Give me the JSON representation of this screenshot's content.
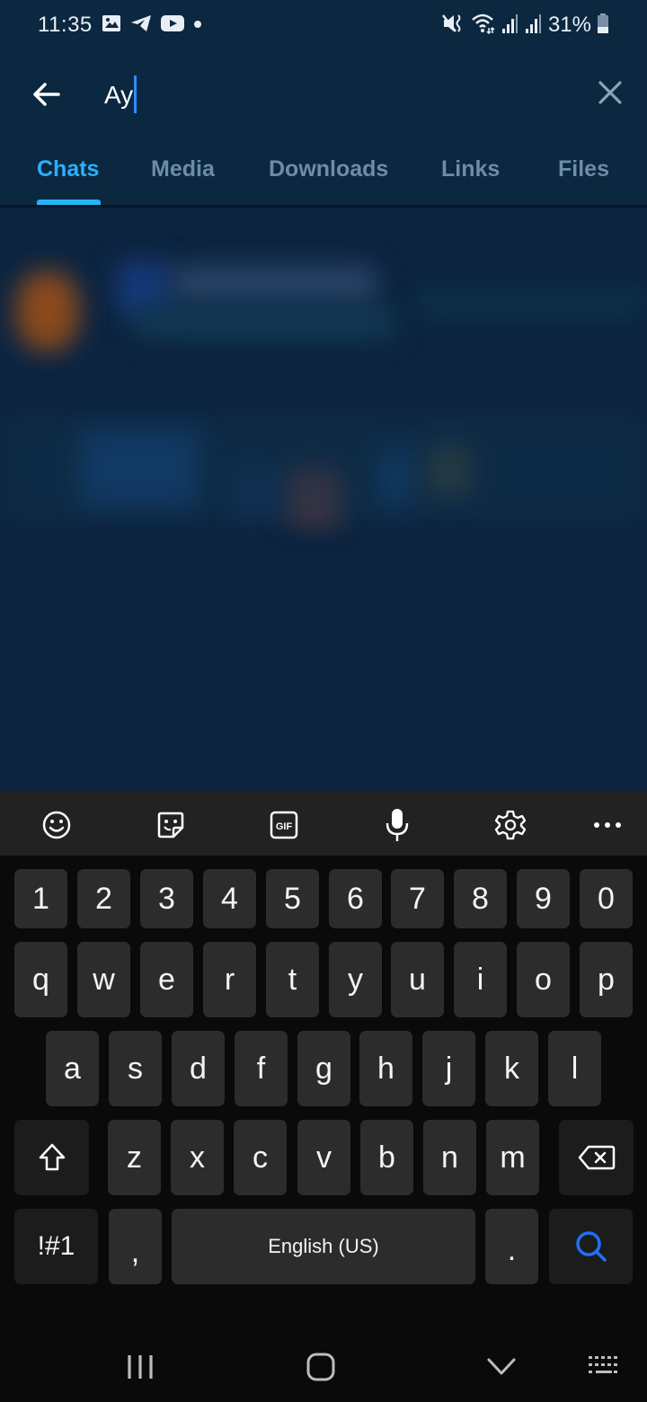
{
  "status_bar": {
    "time": "11:35",
    "battery_percent": "31%",
    "left_icons": [
      "gallery-icon",
      "telegram-icon",
      "youtube-icon",
      "notification-dot-icon"
    ],
    "right_icons": [
      "mute-vibrate-icon",
      "wifi-icon",
      "signal-1-icon",
      "signal-2-icon",
      "battery-icon"
    ]
  },
  "search": {
    "query": "Ay",
    "back_icon": "arrow-left-icon",
    "clear_icon": "close-icon"
  },
  "tabs": [
    {
      "label": "Chats",
      "active": true
    },
    {
      "label": "Media",
      "active": false
    },
    {
      "label": "Downloads",
      "active": false
    },
    {
      "label": "Links",
      "active": false
    },
    {
      "label": "Files",
      "active": false
    }
  ],
  "colors": {
    "app_bg": "#0b2840",
    "accent": "#22b4f5",
    "tab_inactive": "#6d8ca6",
    "keyboard_bg": "#0a0a0a",
    "key_bg": "#2c2c2c",
    "search_key_icon": "#1f6fff"
  },
  "keyboard": {
    "toolbar": [
      "emoji-icon",
      "sticker-icon",
      "gif-icon",
      "microphone-icon",
      "settings-icon",
      "more-icon"
    ],
    "gif_label": "GIF",
    "rows": [
      [
        "1",
        "2",
        "3",
        "4",
        "5",
        "6",
        "7",
        "8",
        "9",
        "0"
      ],
      [
        "q",
        "w",
        "e",
        "r",
        "t",
        "y",
        "u",
        "i",
        "o",
        "p"
      ],
      [
        "a",
        "s",
        "d",
        "f",
        "g",
        "h",
        "j",
        "k",
        "l"
      ],
      [
        "z",
        "x",
        "c",
        "v",
        "b",
        "n",
        "m"
      ]
    ],
    "symbols_label": "!#1",
    "comma_label": ",",
    "space_label": "English (US)",
    "period_label": ".",
    "shift_icon": "shift-icon",
    "backspace_icon": "backspace-icon",
    "action_icon": "search-icon"
  },
  "navbar": {
    "buttons": [
      "recents-icon",
      "home-icon",
      "hide-keyboard-icon",
      "keyboard-switch-icon"
    ]
  }
}
